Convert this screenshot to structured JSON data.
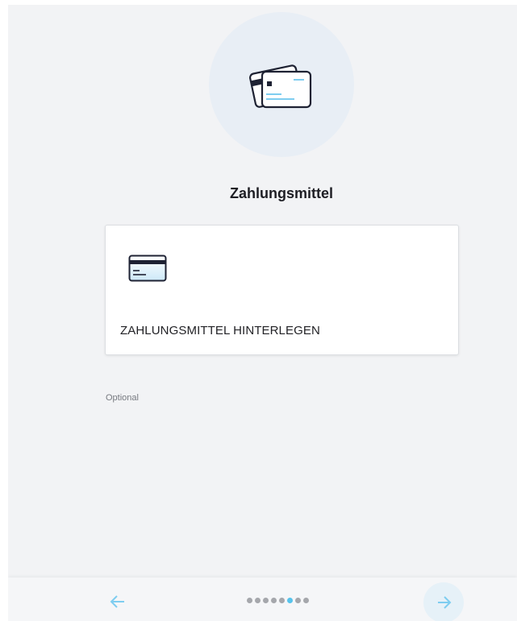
{
  "page": {
    "title": "Zahlungsmittel",
    "optional_label": "Optional"
  },
  "hero": {
    "icon": "payment-cards-icon"
  },
  "card": {
    "icon": "credit-card-icon",
    "label": "ZAHLUNGSMITTEL HINTERLEGEN"
  },
  "footer": {
    "back_icon": "arrow-left-icon",
    "next_icon": "arrow-right-icon",
    "steps_total": 8,
    "active_step": 6
  },
  "colors": {
    "accent": "#56c3ec",
    "background": "#f2f3f5",
    "hero_circle": "#e8eef5",
    "dot_inactive": "#a5a7ac"
  }
}
